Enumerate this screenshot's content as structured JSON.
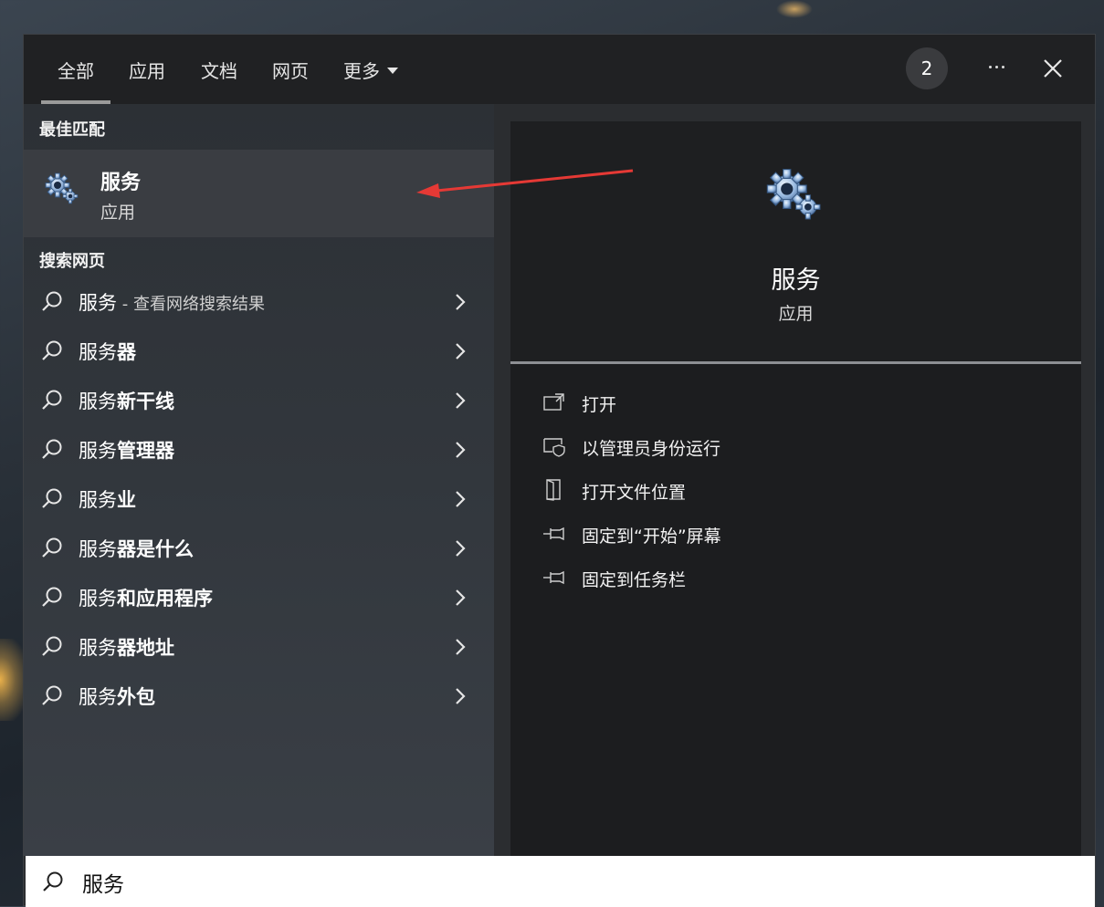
{
  "tabs": [
    {
      "label": "全部",
      "active": true
    },
    {
      "label": "应用",
      "active": false
    },
    {
      "label": "文档",
      "active": false
    },
    {
      "label": "网页",
      "active": false
    },
    {
      "label": "更多",
      "active": false,
      "has_dropdown": true
    }
  ],
  "header": {
    "badge_count": "2",
    "more_icon": "ellipsis-icon",
    "close_icon": "close-icon"
  },
  "best_match": {
    "section_title": "最佳匹配",
    "name": "服务",
    "type": "应用",
    "icon": "gears-icon"
  },
  "web_search": {
    "section_title": "搜索网页",
    "items": [
      {
        "prefix": "服务",
        "suffix": "",
        "hint": " - 查看网络搜索结果"
      },
      {
        "prefix": "服务",
        "suffix": "器",
        "hint": ""
      },
      {
        "prefix": "服务",
        "suffix": "新干线",
        "hint": ""
      },
      {
        "prefix": "服务",
        "suffix": "管理器",
        "hint": ""
      },
      {
        "prefix": "服务",
        "suffix": "业",
        "hint": ""
      },
      {
        "prefix": "服务",
        "suffix": "器是什么",
        "hint": ""
      },
      {
        "prefix": "服务",
        "suffix": "和应用程序",
        "hint": ""
      },
      {
        "prefix": "服务",
        "suffix": "器地址",
        "hint": ""
      },
      {
        "prefix": "服务",
        "suffix": "外包",
        "hint": ""
      }
    ]
  },
  "preview": {
    "title": "服务",
    "subtitle": "应用",
    "actions": [
      {
        "label": "打开",
        "icon": "open-icon"
      },
      {
        "label": "以管理员身份运行",
        "icon": "shield-icon"
      },
      {
        "label": "打开文件位置",
        "icon": "folder-location-icon"
      },
      {
        "label": "固定到“开始”屏幕",
        "icon": "pin-icon"
      },
      {
        "label": "固定到任务栏",
        "icon": "pin-icon"
      }
    ]
  },
  "search": {
    "value": "服务",
    "icon": "search-icon"
  },
  "colors": {
    "annotation_arrow": "#e53935",
    "panel_bg": "#2b2d30",
    "preview_bg": "#1c1d1f"
  }
}
